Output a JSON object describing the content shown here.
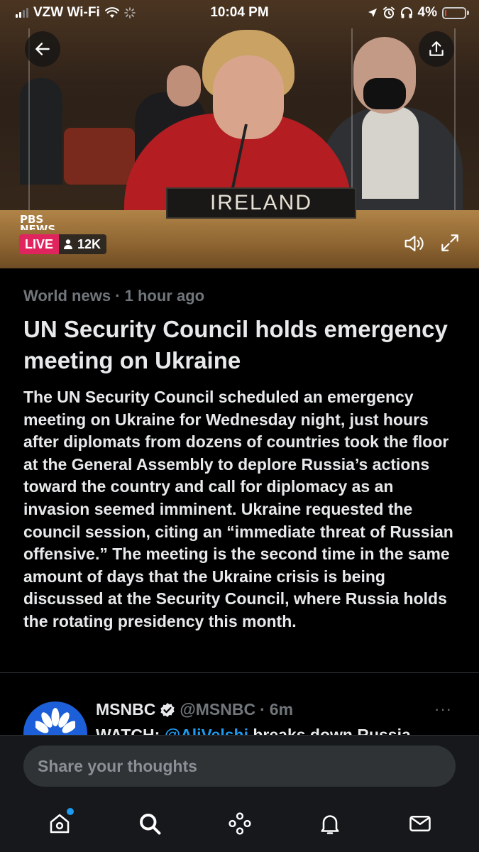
{
  "status_bar": {
    "carrier": "VZW Wi-Fi",
    "time": "10:04 PM",
    "battery": "4%",
    "battery_level": 0.04,
    "battery_color": "#ff3b30"
  },
  "video": {
    "nameplate": "IRELAND",
    "network_logo_line1": "PBS",
    "network_logo_line2": "NEWS",
    "live_label": "LIVE",
    "viewer_count": "12K",
    "icons": {
      "back": "arrow-left-icon",
      "share": "share-icon",
      "volume": "volume-icon",
      "expand": "expand-icon",
      "viewers": "person-icon"
    }
  },
  "article": {
    "category": "World news",
    "separator": "·",
    "time_ago": "1 hour ago",
    "headline": "UN Security Council holds emergency meeting on Ukraine",
    "body": "The UN Security Council scheduled an emergency meeting on Ukraine for Wednesday night, just hours after diplomats from dozens of countries took the floor at the General Assembly to deplore Russia’s actions toward the country and call for diplomacy as an invasion seemed imminent. Ukraine requested the council session, citing an “immediate threat of Russian offensive.” The meeting is the second time in the same amount of days that the Ukraine crisis is being discussed at the Security Council, where Russia holds the rotating presidency this month."
  },
  "tweet": {
    "name": "MSNBC",
    "handle": "@MSNBC",
    "separator": "·",
    "time": "6m",
    "text_prefix": "WATCH: ",
    "mention": "@AliVelshi",
    "text_suffix": " breaks down Russia",
    "more": "···",
    "accent": "#1d9bf0"
  },
  "composer": {
    "placeholder": "Share your thoughts"
  },
  "tabbar": {
    "items": [
      {
        "icon": "home-icon",
        "has_dot": true
      },
      {
        "icon": "search-icon"
      },
      {
        "icon": "spaces-icon"
      },
      {
        "icon": "bell-icon"
      },
      {
        "icon": "mail-icon"
      }
    ]
  }
}
